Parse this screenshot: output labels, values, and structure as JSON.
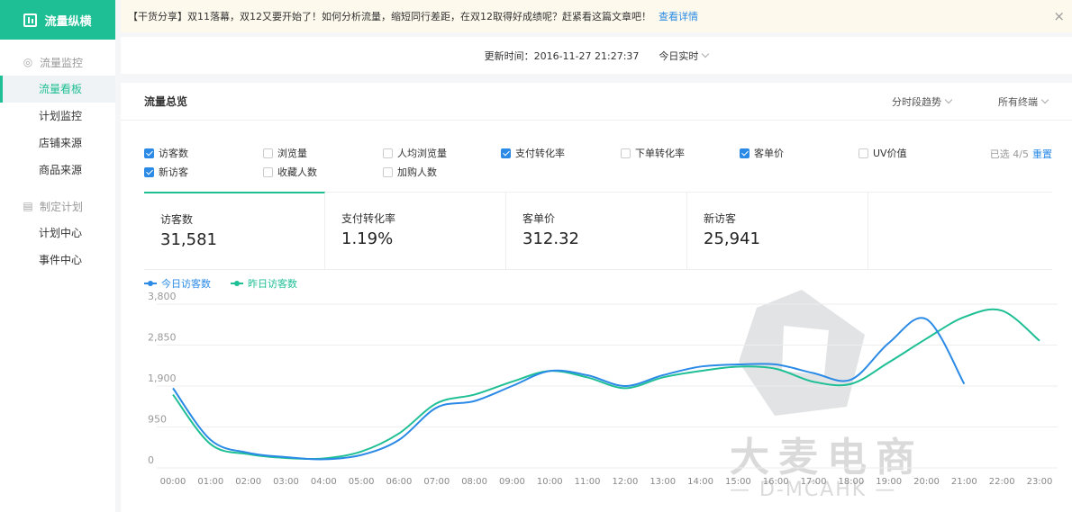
{
  "sidebar": {
    "brand": "流量纵横",
    "groups": [
      {
        "title": "流量监控",
        "items": [
          "流量看板",
          "计划监控",
          "店铺来源",
          "商品来源"
        ]
      },
      {
        "title": "制定计划",
        "items": [
          "计划中心",
          "事件中心"
        ]
      }
    ]
  },
  "notice": {
    "text": "【干货分享】双11落幕，双12又要开始了！如何分析流量，缩短同行差距，在双12取得好成绩呢？赶紧看这篇文章吧！",
    "link": "查看详情",
    "close": "×"
  },
  "update": {
    "label": "更新时间：2016-11-27 21:27:37",
    "mode": "今日实时"
  },
  "panel": {
    "title": "流量总览",
    "trend_ctrl": "分时段趋势",
    "terminal_ctrl": "所有终端"
  },
  "checkboxes": [
    {
      "label": "访客数",
      "checked": true
    },
    {
      "label": "浏览量",
      "checked": false
    },
    {
      "label": "人均浏览量",
      "checked": false
    },
    {
      "label": "支付转化率",
      "checked": true
    },
    {
      "label": "下单转化率",
      "checked": false
    },
    {
      "label": "客单价",
      "checked": true
    },
    {
      "label": "UV价值",
      "checked": false
    },
    {
      "label": "新访客",
      "checked": true
    },
    {
      "label": "收藏人数",
      "checked": false
    },
    {
      "label": "加购人数",
      "checked": false
    }
  ],
  "selection": {
    "info": "已选 4/5",
    "reset": "重置"
  },
  "metrics": [
    {
      "label": "访客数",
      "value": "31,581"
    },
    {
      "label": "支付转化率",
      "value": "1.19%"
    },
    {
      "label": "客单价",
      "value": "312.32"
    },
    {
      "label": "新访客",
      "value": "25,941"
    }
  ],
  "watermark": {
    "main": "大麦电商",
    "sub": "— D-MCAHK —"
  },
  "colors": {
    "accent": "#1fbf95",
    "today": "#2a8ae6",
    "yesterday": "#1fbf95"
  },
  "chart_data": {
    "type": "line",
    "x": [
      "00:00",
      "01:00",
      "02:00",
      "03:00",
      "04:00",
      "05:00",
      "06:00",
      "07:00",
      "08:00",
      "09:00",
      "10:00",
      "11:00",
      "12:00",
      "13:00",
      "14:00",
      "15:00",
      "16:00",
      "17:00",
      "18:00",
      "19:00",
      "20:00",
      "21:00",
      "22:00",
      "23:00"
    ],
    "ylim": [
      0,
      3800
    ],
    "yticks": [
      0,
      950,
      1900,
      2850,
      3800
    ],
    "grid": true,
    "legend_position": "top-left",
    "series": [
      {
        "name": "今日访客数",
        "color": "#2a8ae6",
        "values": [
          1850,
          650,
          350,
          250,
          200,
          300,
          650,
          1400,
          1550,
          1900,
          2250,
          2150,
          1900,
          2150,
          2350,
          2400,
          2400,
          2200,
          2050,
          2900,
          3450,
          1950,
          null,
          null
        ]
      },
      {
        "name": "昨日访客数",
        "color": "#1fbf95",
        "values": [
          1700,
          550,
          320,
          230,
          220,
          380,
          800,
          1500,
          1700,
          2000,
          2250,
          2100,
          1850,
          2100,
          2250,
          2350,
          2300,
          2000,
          1950,
          2450,
          3000,
          3500,
          3650,
          2950
        ]
      }
    ]
  }
}
